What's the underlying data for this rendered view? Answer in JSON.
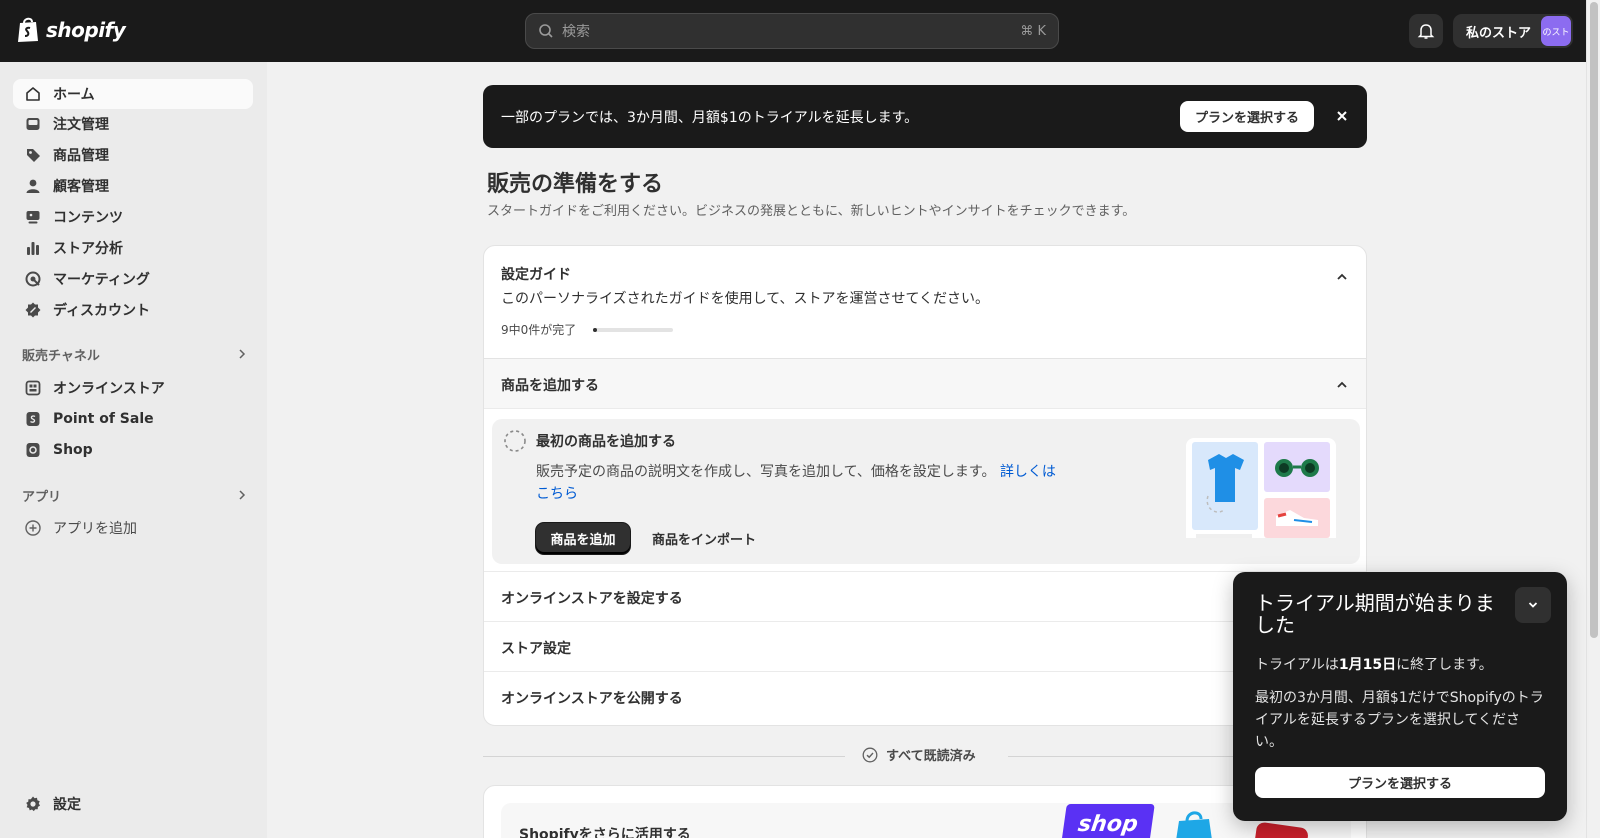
{
  "topbar": {
    "logo_text": "shopify",
    "search_placeholder": "検索",
    "search_shortcut": "⌘ K",
    "store_name": "私のストア",
    "store_avatar_text": "のスト"
  },
  "sidebar": {
    "items": [
      {
        "label": "ホーム",
        "icon": "home-icon",
        "active": true
      },
      {
        "label": "注文管理",
        "icon": "inbox-icon"
      },
      {
        "label": "商品管理",
        "icon": "tag-icon"
      },
      {
        "label": "顧客管理",
        "icon": "person-icon"
      },
      {
        "label": "コンテンツ",
        "icon": "content-icon"
      },
      {
        "label": "ストア分析",
        "icon": "bar-chart-icon"
      },
      {
        "label": "マーケティング",
        "icon": "target-icon"
      },
      {
        "label": "ディスカウント",
        "icon": "discount-icon"
      }
    ],
    "sales_channels": {
      "title": "販売チャネル",
      "items": [
        {
          "label": "オンラインストア",
          "icon": "online-store-icon"
        },
        {
          "label": "Point of Sale",
          "icon": "pos-icon"
        },
        {
          "label": "Shop",
          "icon": "shop-icon"
        }
      ]
    },
    "apps": {
      "title": "アプリ",
      "add_label": "アプリを追加"
    },
    "settings_label": "設定"
  },
  "banner": {
    "text": "一部のプランでは、3か月間、月額$1のトライアルを延長します。",
    "button": "プランを選択する"
  },
  "page": {
    "title": "販売の準備をする",
    "subtitle": "スタートガイドをご利用ください。ビジネスの発展とともに、新しいヒントやインサイトをチェックできます。"
  },
  "guide": {
    "title": "設定ガイド",
    "description": "このパーソナライズされたガイドを使用して、ストアを運営させてください。",
    "progress_label": "9中0件が完了",
    "progress_fraction": 0,
    "open_step": {
      "label": "商品を追加する",
      "task_title": "最初の商品を追加する",
      "task_desc": "販売予定の商品の説明文を作成し、写真を追加して、価格を設定します。",
      "learn_more": "詳しくはこちら",
      "primary_button": "商品を追加",
      "secondary_button": "商品をインポート"
    },
    "steps": [
      {
        "label": "オンラインストアを設定する"
      },
      {
        "label": "ストア設定"
      },
      {
        "label": "オンラインストアを公開する"
      }
    ]
  },
  "read_all_label": "すべて既読済み",
  "more_card": {
    "title": "Shopifyをさらに活用する",
    "shop_logo_text": "shop"
  },
  "popup": {
    "title": "トライアル期間が始まりました",
    "line1_prefix": "トライアルは",
    "line1_date": "1月15日",
    "line1_suffix": "に終了します。",
    "line2": "最初の3か月間、月額$1だけでShopifyのトライアルを延長するプランを選択してください。",
    "button": "プランを選択する"
  },
  "colors": {
    "topbar": "#1a1a1a",
    "accent_link": "#005bd3",
    "avatar": "#8c6cf0",
    "shop_brand": "#5a31f4"
  }
}
